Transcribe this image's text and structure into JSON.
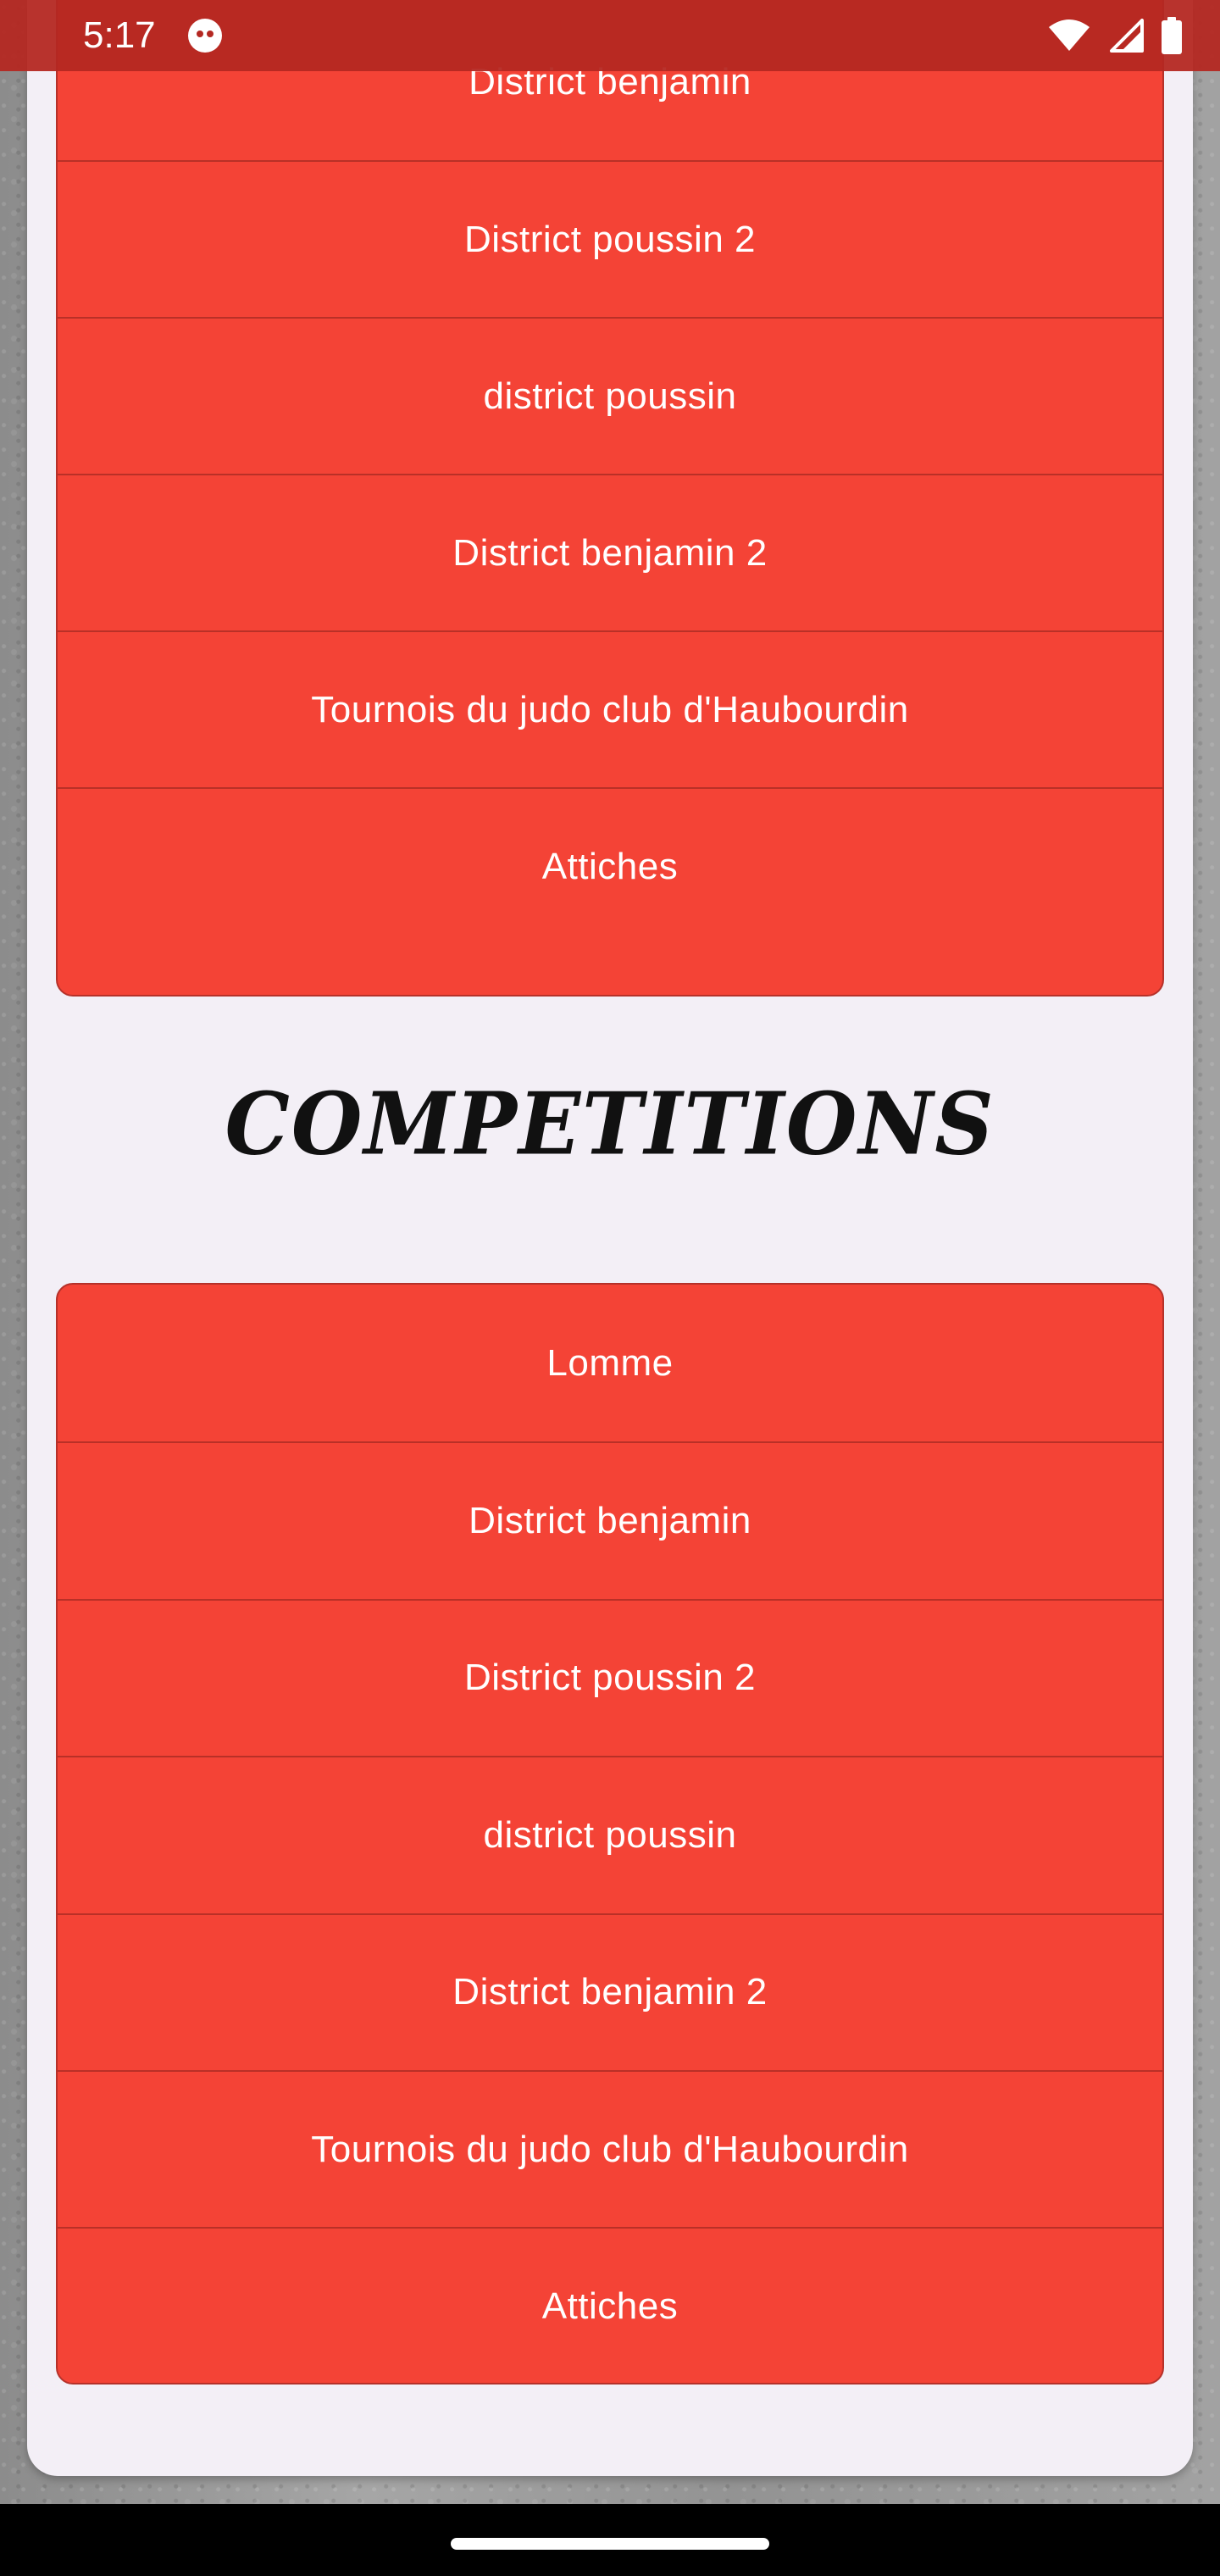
{
  "status_bar": {
    "time": "5:17",
    "icons": [
      "app-notification-icon",
      "wifi-icon",
      "signal-icon",
      "battery-icon"
    ]
  },
  "top_menu": {
    "items": [
      {
        "label": "District benjamin"
      },
      {
        "label": "District poussin 2"
      },
      {
        "label": "district poussin"
      },
      {
        "label": "District benjamin 2"
      },
      {
        "label": "Tournois du judo club d'Haubourdin"
      },
      {
        "label": "Attiches"
      }
    ]
  },
  "competitions": {
    "title": "COMPETITIONS",
    "items": [
      {
        "label": "Lomme"
      },
      {
        "label": "District benjamin"
      },
      {
        "label": "District poussin 2"
      },
      {
        "label": "district poussin"
      },
      {
        "label": "District benjamin 2"
      },
      {
        "label": "Tournois du judo club d'Haubourdin"
      },
      {
        "label": "Attiches"
      }
    ]
  },
  "colors": {
    "menu_red": "#f44336",
    "divider": "#b93027",
    "card_bg": "#f3eff6",
    "status_bar": "#b42822"
  }
}
